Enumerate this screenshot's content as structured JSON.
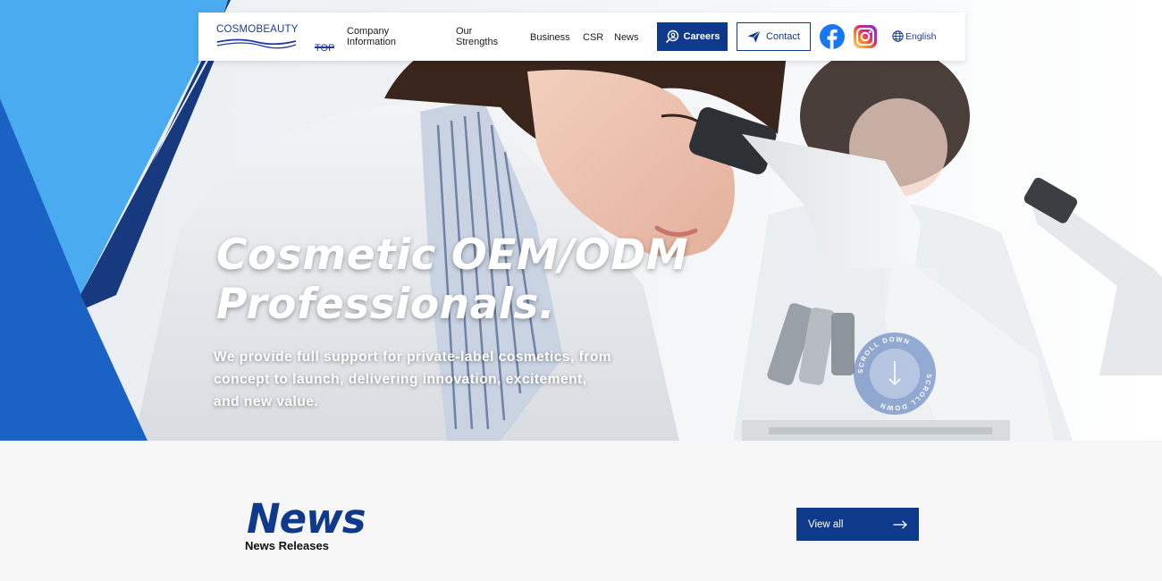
{
  "brand": {
    "logo_text": "COSMOBEAUTY",
    "primary_color": "#0f3a8c",
    "accent_light_blue": "#4aabf0",
    "mid_blue": "#1a62c4",
    "dark_blue": "#17397d"
  },
  "nav": {
    "items": [
      {
        "label": "TOP",
        "active": true
      },
      {
        "label": "Company\nInformation"
      },
      {
        "label": "Our\nStrengths"
      },
      {
        "label": "Business"
      },
      {
        "label": "CSR"
      },
      {
        "label": "News"
      }
    ],
    "careers_label": "Careers",
    "contact_label": "Contact",
    "language_label": "English",
    "social": [
      "facebook-icon",
      "instagram-icon"
    ]
  },
  "hero": {
    "title_line1": "Cosmetic OEM/ODM",
    "title_line2": "Professionals.",
    "subtitle": "We provide full support for private-label cosmetics, from concept to launch, delivering innovation, excitement, and new value.",
    "scroll_label": "SCROLL DOWN"
  },
  "news": {
    "title": "News",
    "subtitle": "News Releases",
    "view_all_label": "View all"
  }
}
